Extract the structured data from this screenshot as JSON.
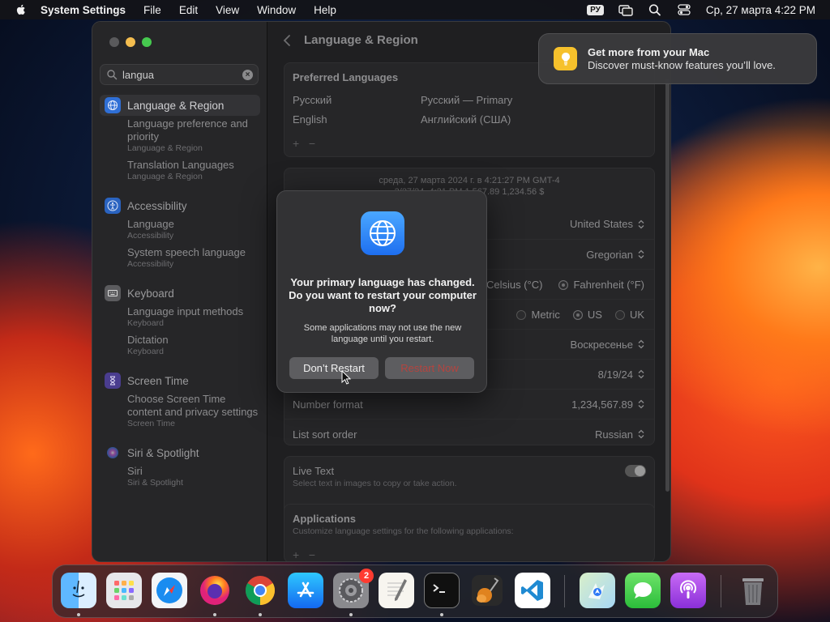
{
  "menubar": {
    "app_name": "System Settings",
    "items": [
      "File",
      "Edit",
      "View",
      "Window",
      "Help"
    ],
    "keyboard_layout": "РУ",
    "clock": "Ср, 27 марта  4:22 PM"
  },
  "sidebar": {
    "search_value": "langua",
    "categories": [
      {
        "label": "Language & Region",
        "results": [
          {
            "title": "Language preference and priority",
            "category": "Language & Region"
          },
          {
            "title": "Translation Languages",
            "category": "Language & Region"
          }
        ]
      },
      {
        "label": "Accessibility",
        "results": [
          {
            "title": "Language",
            "category": "Accessibility"
          },
          {
            "title": "System speech language",
            "category": "Accessibility"
          }
        ]
      },
      {
        "label": "Keyboard",
        "results": [
          {
            "title": "Language input methods",
            "category": "Keyboard"
          },
          {
            "title": "Dictation",
            "category": "Keyboard"
          }
        ]
      },
      {
        "label": "Screen Time",
        "results": [
          {
            "title": "Choose Screen Time content and privacy settings",
            "category": "Screen Time"
          }
        ]
      },
      {
        "label": "Siri & Spotlight",
        "results": [
          {
            "title": "Siri",
            "category": "Siri & Spotlight"
          }
        ]
      }
    ]
  },
  "main": {
    "title": "Language & Region",
    "preferred_languages": {
      "heading": "Preferred Languages",
      "rows": [
        {
          "name": "Русский",
          "detail": "Русский — Primary"
        },
        {
          "name": "English",
          "detail": "Английский (США)"
        }
      ],
      "add": "+",
      "remove": "−"
    },
    "format_preview": {
      "line1": "среда, 27 марта 2024 г. в 4:21:27 PM GMT-4",
      "line2": "3/27/24, 4:21 PM   1,567.89   1,234.56 $"
    },
    "settings": {
      "region": "United States",
      "calendar": "Gregorian",
      "temp_celsius": "Celsius (°C)",
      "temp_fahrenheit": "Fahrenheit (°F)",
      "measure_metric": "Metric",
      "measure_us": "US",
      "measure_uk": "UK",
      "first_day": "Воскресенье",
      "date_format": "8/19/24",
      "number_format_label": "Number format",
      "number_format": "1,234,567.89",
      "list_sort_label": "List sort order",
      "list_sort": "Russian"
    },
    "live_text": {
      "label": "Live Text",
      "desc": "Select text in images to copy or take action."
    },
    "applications": {
      "label": "Applications",
      "desc": "Customize language settings for the following applications:",
      "add": "+",
      "remove": "−"
    }
  },
  "notification": {
    "title": "Get more from your Mac",
    "body": "Discover must-know features you’ll love."
  },
  "dialog": {
    "title": "Your primary language has changed. Do you want to restart your computer now?",
    "body": "Some applications may not use the new language until you restart.",
    "dont_restart": "Don’t Restart",
    "restart_now": "Restart Now"
  },
  "dock": {
    "items": [
      "finder-icon",
      "launchpad-icon",
      "safari-icon",
      "firefox-icon",
      "chrome-icon",
      "app-store-icon",
      "system-settings-icon",
      "textedit-icon",
      "terminal-icon",
      "garageband-icon",
      "vscode-icon",
      "maps-icon",
      "messages-icon",
      "podcasts-icon",
      "trash-icon"
    ],
    "settings_badge": "2"
  },
  "colors": {
    "accent_blue": "#1e6ff0",
    "notification_icon": "#f6c12c",
    "restart_text": "#b4443f"
  }
}
